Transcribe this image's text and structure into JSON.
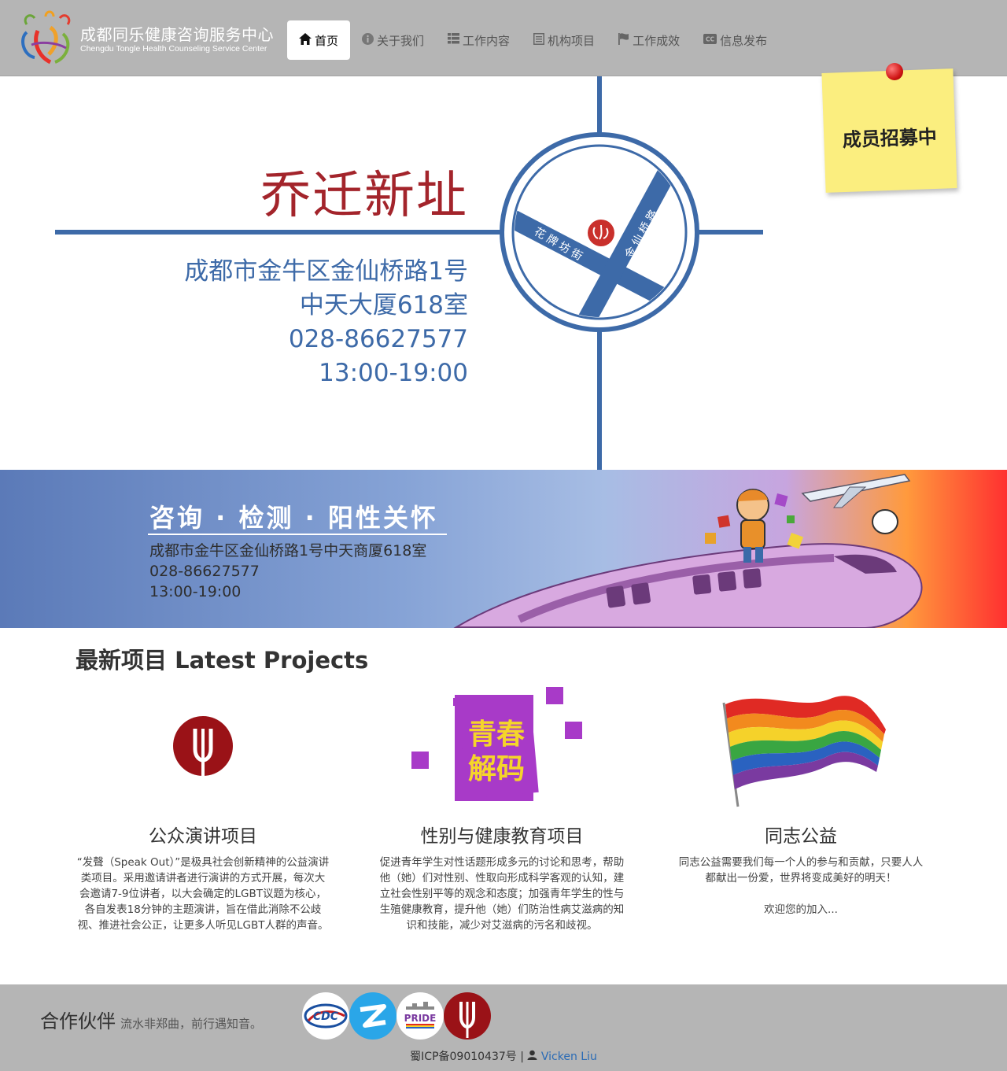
{
  "brand": {
    "name_cn": "成都同乐健康咨询服务中心",
    "name_en": "Chengdu Tongle Health Counseling Service Center"
  },
  "nav": {
    "items": [
      {
        "label": "首页",
        "icon": "home-icon",
        "active": true
      },
      {
        "label": "关于我们",
        "icon": "info-icon"
      },
      {
        "label": "工作内容",
        "icon": "list-icon"
      },
      {
        "label": "机构项目",
        "icon": "document-icon"
      },
      {
        "label": "工作成效",
        "icon": "flag-icon"
      },
      {
        "label": "信息发布",
        "icon": "closed-caption-icon"
      }
    ]
  },
  "hero": {
    "title": "乔迁新址",
    "address_line1": "成都市金牛区金仙桥路1号",
    "address_line2": "中天大厦618室",
    "phone": "028-86627577",
    "hours": "13:00-19:00",
    "map_street_1": "花牌坊街",
    "map_street_2": "金仙桥路",
    "sticky_note": "成员招募中",
    "colors": {
      "title": "#a3242b",
      "text": "#3d6aa8",
      "map_lines": "#3d6aa8",
      "sticky": "#fbee7f"
    }
  },
  "banner": {
    "title": "咨询 · 检测 · 阳性关怀",
    "address": "成都市金牛区金仙桥路1号中天商厦618室",
    "phone": "028-86627577",
    "hours": "13:00-19:00"
  },
  "projects": {
    "heading": "最新项目 Latest Projects",
    "items": [
      {
        "title": "公众演讲项目",
        "image": "speak-out-logo",
        "desc": "“发聲（Speak Out）”是极具社会创新精神的公益演讲类项目。采用邀请讲者进行演讲的方式开展，每次大会邀请7-9位讲者，以大会确定的LGBT议题为核心，各自发表18分钟的主题演讲，旨在借此消除不公歧视、推进社会公正，让更多人听见LGBT人群的声音。"
      },
      {
        "title": "性别与健康教育项目",
        "image": "youth-decode-logo",
        "image_text_1": "青春",
        "image_text_2": "解码",
        "desc": "促进青年学生对性话题形成多元的讨论和思考，帮助他（她）们对性别、性取向形成科学客观的认知，建立社会性别平等的观念和态度；加强青年学生的性与生殖健康教育，提升他（她）们防治性病艾滋病的知识和技能，减少对艾滋病的污名和歧视。"
      },
      {
        "title": "同志公益",
        "image": "rainbow-flag",
        "desc": "同志公益需要我们每一个人的参与和贡献，只要人人都献出一份爱，世界将变成美好的明天！",
        "desc2": "欢迎您的加入..."
      }
    ]
  },
  "footer": {
    "partners_label": "合作伙伴",
    "partners_sub": "流水非郑曲，前行遇知音。",
    "partners": [
      "cdc-logo",
      "blue-bird-logo",
      "pride-logo",
      "speak-out-logo"
    ],
    "partner_text": {
      "cdc": "CDC",
      "pride": "PRIDE"
    },
    "icp": "蜀ICP备09010437号 |",
    "author": "Vicken Liu",
    "author_icon": "user-icon"
  }
}
